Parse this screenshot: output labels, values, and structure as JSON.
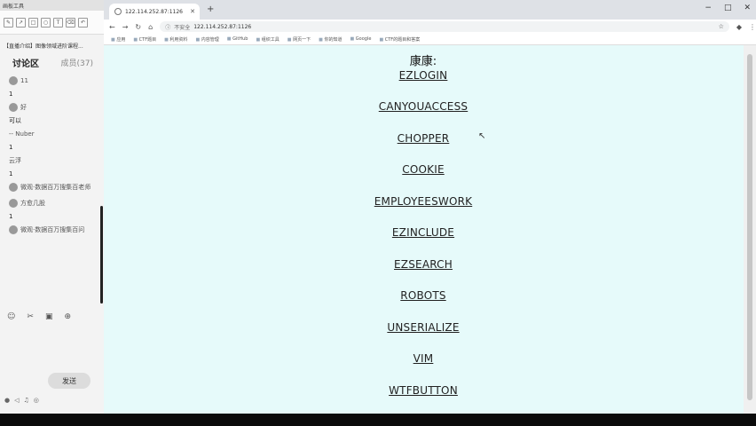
{
  "side_panel": {
    "title": "画板工具",
    "course": "【直播介绍】图像领域进阶课程...",
    "tab_discussion": "讨论区",
    "tab_members": "成员(37)",
    "messages": [
      {
        "text": "11"
      },
      {
        "text": "1"
      },
      {
        "text": "好"
      },
      {
        "text": "可以"
      },
      {
        "text": "-- Nuber"
      },
      {
        "text": "1"
      },
      {
        "text": "云浮"
      },
      {
        "text": "1"
      },
      {
        "text": "微观·数据百万搜集百老师"
      },
      {
        "text": "方愈几股"
      },
      {
        "text": "1"
      },
      {
        "text": "微观·数据百万搜集百问"
      }
    ],
    "send_label": "发送"
  },
  "browser": {
    "tab_title": "122.114.252.87:1126",
    "security_label": "不安全",
    "url": "122.114.252.87:1126",
    "bookmarks": [
      "应用",
      "CTF题目",
      "利用资料",
      "内容管理",
      "GitHub",
      "组织工具",
      "网页一下",
      "你的知道",
      "Google",
      "CTF的题目和答案"
    ]
  },
  "page": {
    "heading": "康康:",
    "links": [
      "EZLOGIN",
      "CANYOUACCESS",
      "CHOPPER",
      "COOKIE",
      "EMPLOYEESWORK",
      "EZINCLUDE",
      "EZSEARCH",
      "ROBOTS",
      "UNSERIALIZE",
      "VIM",
      "WTFBUTTON"
    ]
  },
  "colors": {
    "page_background": "#e6fafa",
    "link_color": "#222222"
  }
}
